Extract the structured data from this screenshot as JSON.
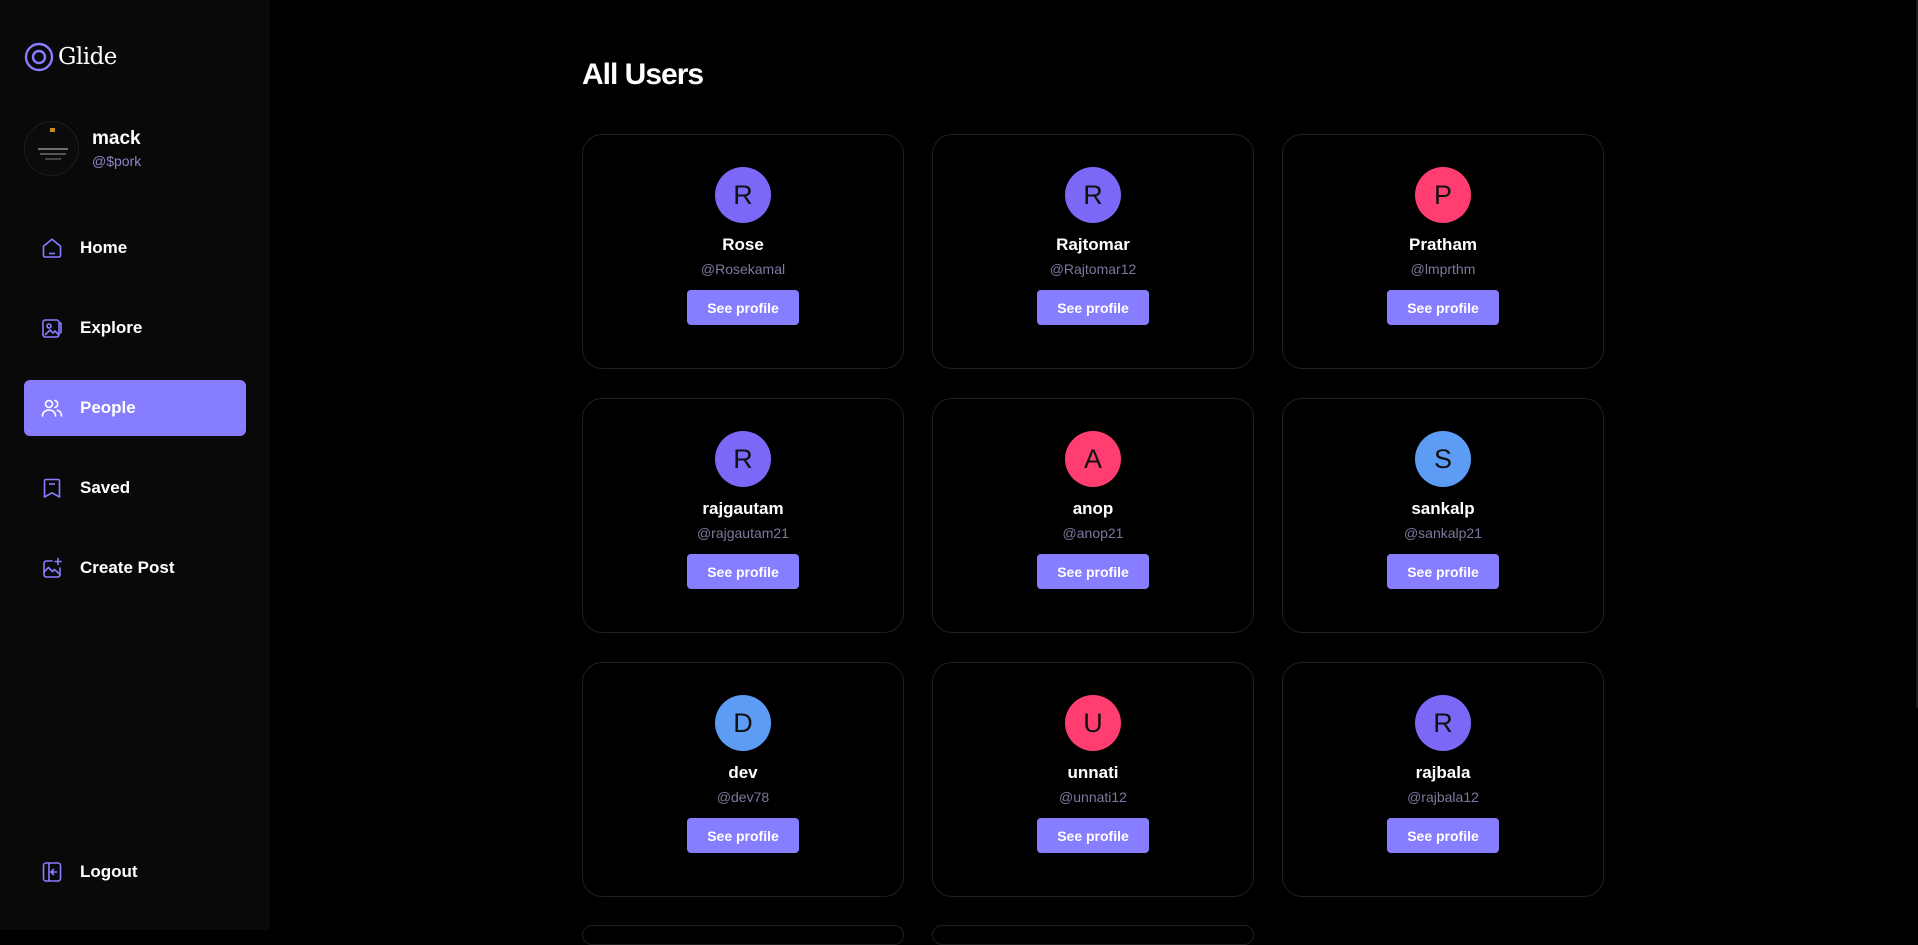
{
  "app": {
    "name": "Glide",
    "logo_icon": "glide-logo-icon"
  },
  "profile": {
    "name": "mack",
    "handle": "@$pork"
  },
  "nav": {
    "items": [
      {
        "label": "Home",
        "icon": "home-icon",
        "active": false
      },
      {
        "label": "Explore",
        "icon": "explore-icon",
        "active": false
      },
      {
        "label": "People",
        "icon": "people-icon",
        "active": true
      },
      {
        "label": "Saved",
        "icon": "bookmark-icon",
        "active": false
      },
      {
        "label": "Create Post",
        "icon": "create-post-icon",
        "active": false
      }
    ],
    "logout": "Logout"
  },
  "page": {
    "title": "All Users"
  },
  "users": [
    {
      "initial": "R",
      "name": "Rose",
      "handle": "@Rosekamal",
      "color": "#7b68f7",
      "button": "See profile"
    },
    {
      "initial": "R",
      "name": "Rajtomar",
      "handle": "@Rajtomar12",
      "color": "#7b68f7",
      "button": "See profile"
    },
    {
      "initial": "P",
      "name": "Pratham",
      "handle": "@lmprthm",
      "color": "#ff3d71",
      "button": "See profile"
    },
    {
      "initial": "R",
      "name": "rajgautam",
      "handle": "@rajgautam21",
      "color": "#7b68f7",
      "button": "See profile"
    },
    {
      "initial": "A",
      "name": "anop",
      "handle": "@anop21",
      "color": "#ff3d71",
      "button": "See profile"
    },
    {
      "initial": "S",
      "name": "sankalp",
      "handle": "@sankalp21",
      "color": "#5c9cf5",
      "button": "See profile"
    },
    {
      "initial": "D",
      "name": "dev",
      "handle": "@dev78",
      "color": "#5c9cf5",
      "button": "See profile"
    },
    {
      "initial": "U",
      "name": "unnati",
      "handle": "@unnati12",
      "color": "#ff3d71",
      "button": "See profile"
    },
    {
      "initial": "R",
      "name": "rajbala",
      "handle": "@rajbala12",
      "color": "#7b68f7",
      "button": "See profile"
    }
  ],
  "theme": {
    "accent": "#877eff",
    "sidebar_bg": "#09090a",
    "background": "#000000"
  }
}
